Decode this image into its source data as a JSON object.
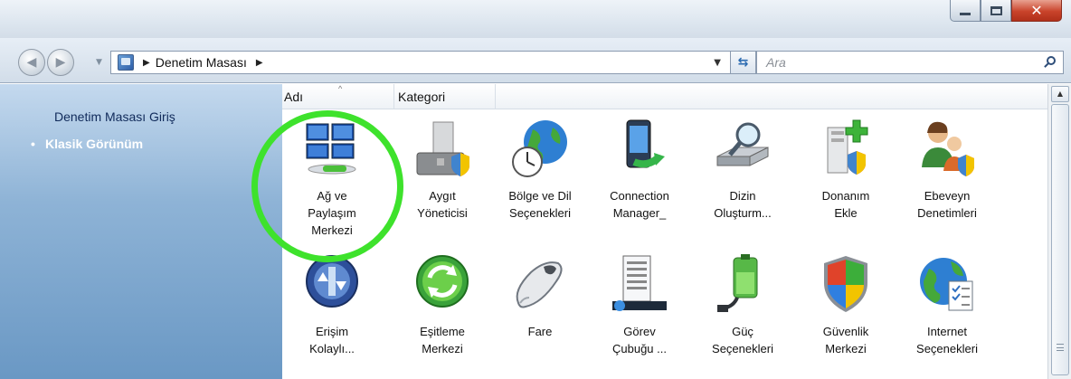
{
  "window": {
    "minimize_label": "",
    "maximize_label": "",
    "close_glyph": "✕"
  },
  "nav": {
    "breadcrumb": "Denetim Masası",
    "search_placeholder": "Ara"
  },
  "sidebar": {
    "home_link": "Denetim Masası Giriş",
    "active_item": "Klasik Görünüm"
  },
  "columns": {
    "name": "Adı",
    "category": "Kategori"
  },
  "items": [
    {
      "line1": "Ağ ve",
      "line2": "Paylaşım",
      "line3": "Merkezi",
      "icon": "network-sharing-icon"
    },
    {
      "line1": "Aygıt",
      "line2": "Yöneticisi",
      "line3": "",
      "icon": "device-manager-icon"
    },
    {
      "line1": "Bölge ve Dil",
      "line2": "Seçenekleri",
      "line3": "",
      "icon": "region-language-icon"
    },
    {
      "line1": "Connection",
      "line2": "Manager_",
      "line3": "",
      "icon": "connection-manager-icon"
    },
    {
      "line1": "Dizin",
      "line2": "Oluşturm...",
      "line3": "",
      "icon": "indexing-icon"
    },
    {
      "line1": "Donanım",
      "line2": "Ekle",
      "line3": "",
      "icon": "add-hardware-icon"
    },
    {
      "line1": "Ebeveyn",
      "line2": "Denetimleri",
      "line3": "",
      "icon": "parental-controls-icon"
    },
    {
      "line1": "Erişim",
      "line2": "Kolaylı...",
      "line3": "",
      "icon": "ease-of-access-icon"
    },
    {
      "line1": "Eşitleme",
      "line2": "Merkezi",
      "line3": "",
      "icon": "sync-center-icon"
    },
    {
      "line1": "Fare",
      "line2": "",
      "line3": "",
      "icon": "mouse-icon"
    },
    {
      "line1": "Görev",
      "line2": "Çubuğu ...",
      "line3": "",
      "icon": "taskbar-icon"
    },
    {
      "line1": "Güç",
      "line2": "Seçenekleri",
      "line3": "",
      "icon": "power-options-icon"
    },
    {
      "line1": "Güvenlik",
      "line2": "Merkezi",
      "line3": "",
      "icon": "security-center-icon"
    },
    {
      "line1": "Internet",
      "line2": "Seçenekleri",
      "line3": "",
      "icon": "internet-options-icon"
    }
  ],
  "colors": {
    "highlight_circle": "#3ee22c",
    "sidebar_top": "#c4d9ee",
    "sidebar_bottom": "#6a98c4"
  }
}
